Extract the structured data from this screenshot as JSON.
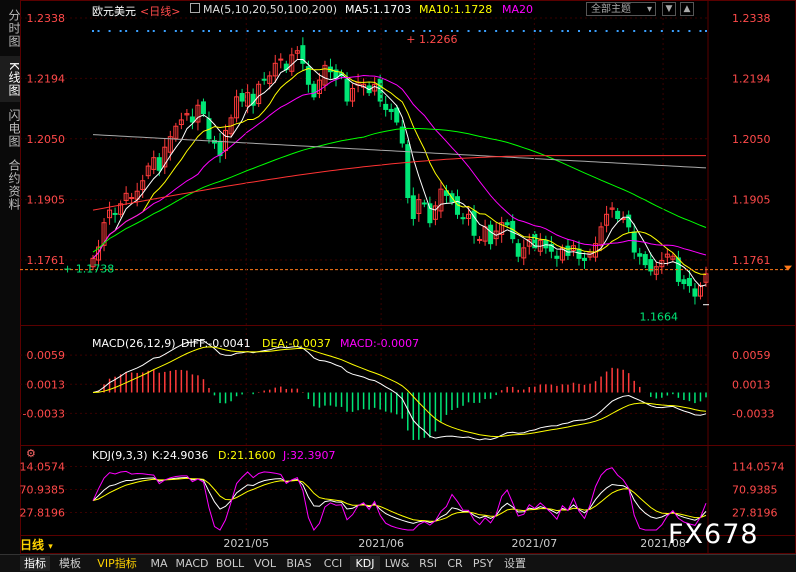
{
  "sidebar": {
    "items": [
      {
        "label": "分时图",
        "active": false
      },
      {
        "label": "K线图",
        "active": true
      },
      {
        "label": "闪电图",
        "active": false
      },
      {
        "label": "合约资料",
        "active": false
      }
    ]
  },
  "header": {
    "symbol": "欧元美元",
    "period": "<日线>",
    "ma_label": "MA(5,10,20,50,100,200)",
    "ma5": "MA5:1.1703",
    "ma10": "MA10:1.1728",
    "ma20": "MA20",
    "theme_select": "全部主题",
    "ctl_down": "▼",
    "ctl_up": "▲"
  },
  "macd_header": {
    "label": "MACD(26,12,9)",
    "diff": "DIFF:-0.0041",
    "dea": "DEA:-0.0037",
    "macd": "MACD:-0.0007"
  },
  "kdj_header": {
    "label": "KDJ(9,3,3)",
    "k": "K:24.9036",
    "d": "D:21.1600",
    "j": "J:32.3907"
  },
  "period_tab": "日线",
  "watermark": "FX678",
  "bottom_tabs": [
    {
      "label": "指标",
      "active": true
    },
    {
      "label": "模板",
      "active": false
    },
    {
      "label": "VIP指标",
      "active": false,
      "vip": true
    },
    {
      "label": "MA",
      "active": false
    },
    {
      "label": "MACD",
      "active": false
    },
    {
      "label": "BOLL",
      "active": false
    },
    {
      "label": "VOL",
      "active": false
    },
    {
      "label": "BIAS",
      "active": false
    },
    {
      "label": "CCI",
      "active": false
    },
    {
      "label": "KDJ",
      "active": true
    },
    {
      "label": "LW&",
      "active": false
    },
    {
      "label": "RSI",
      "active": false
    },
    {
      "label": "CR",
      "active": false
    },
    {
      "label": "PSY",
      "active": false
    },
    {
      "label": "设置",
      "active": false
    }
  ],
  "colors": {
    "up": "#ff3b3b",
    "down": "#00e676",
    "ma5": "#ffffff",
    "ma10": "#ffff00",
    "ma20": "#ff00ff",
    "ma50": "#00ff00",
    "ma100": "#aaaaaa",
    "ma200": "#ff3333",
    "axis_text": "#ff4a4a",
    "grid": "#3a0000"
  },
  "chart_data": [
    {
      "type": "candlestick",
      "title": "欧元美元 <日线>",
      "x_ticks": [
        "2021/05",
        "2021/06",
        "2021/07",
        "2021/08"
      ],
      "y_ticks": [
        1.2338,
        1.2194,
        1.205,
        1.1905,
        1.1761
      ],
      "ylim": [
        1.1618,
        1.2338
      ],
      "annotations": [
        {
          "text": "1.2266",
          "x": 56,
          "y": 1.2266
        },
        {
          "text": "1.1738",
          "x": 0,
          "y": 1.1738
        },
        {
          "text": "1.1664",
          "x": 152,
          "y": 1.1664
        }
      ],
      "current_price": 1.1728,
      "closes": [
        1.1765,
        1.1792,
        1.185,
        1.188,
        1.187,
        1.1895,
        1.192,
        1.191,
        1.1925,
        1.195,
        1.1985,
        1.2005,
        1.1975,
        1.203,
        1.2055,
        1.208,
        1.2095,
        1.211,
        1.209,
        1.213,
        1.211,
        1.205,
        1.204,
        1.201,
        1.207,
        1.21,
        1.215,
        1.214,
        1.216,
        1.213,
        1.218,
        1.219,
        1.22,
        1.223,
        1.224,
        1.2215,
        1.225,
        1.226,
        1.223,
        1.218,
        1.215,
        1.219,
        1.2225,
        1.221,
        1.2195,
        1.22,
        1.214,
        1.217,
        1.2185,
        1.218,
        1.216,
        1.218,
        1.214,
        1.212,
        1.2115,
        1.209,
        1.204,
        1.191,
        1.186,
        1.1905,
        1.1895,
        1.185,
        1.189,
        1.193,
        1.1915,
        1.19,
        1.187,
        1.186,
        1.187,
        1.182,
        1.181,
        1.184,
        1.18,
        1.183,
        1.185,
        1.1845,
        1.1812,
        1.177,
        1.179,
        1.181,
        1.179,
        1.1808,
        1.179,
        1.1782,
        1.1765,
        1.179,
        1.1772,
        1.1795,
        1.1765,
        1.176,
        1.178,
        1.18,
        1.184,
        1.187,
        1.1885,
        1.186,
        1.186,
        1.184,
        1.178,
        1.177,
        1.175,
        1.1735,
        1.1745,
        1.176,
        1.1775,
        1.177,
        1.171,
        1.1705,
        1.17,
        1.1675,
        1.17,
        1.1728
      ],
      "series": [
        {
          "name": "MA5",
          "value": 1.1703
        },
        {
          "name": "MA10",
          "value": 1.1728
        },
        {
          "name": "MA20"
        }
      ]
    },
    {
      "type": "bar+line",
      "title": "MACD(26,12,9)",
      "y_ticks": [
        0.0059,
        0.0013,
        -0.0033
      ],
      "ylim": [
        -0.0075,
        0.0075
      ],
      "series": [
        {
          "name": "DIFF",
          "last": -0.0041
        },
        {
          "name": "DEA",
          "last": -0.0037
        },
        {
          "name": "MACD",
          "last": -0.0007
        }
      ]
    },
    {
      "type": "line",
      "title": "KDJ(9,3,3)",
      "y_ticks": [
        114.0574,
        70.9385,
        27.8196
      ],
      "ylim": [
        -5,
        130
      ],
      "series": [
        {
          "name": "K",
          "last": 24.9036
        },
        {
          "name": "D",
          "last": 21.16
        },
        {
          "name": "J",
          "last": 32.3907
        }
      ]
    }
  ]
}
